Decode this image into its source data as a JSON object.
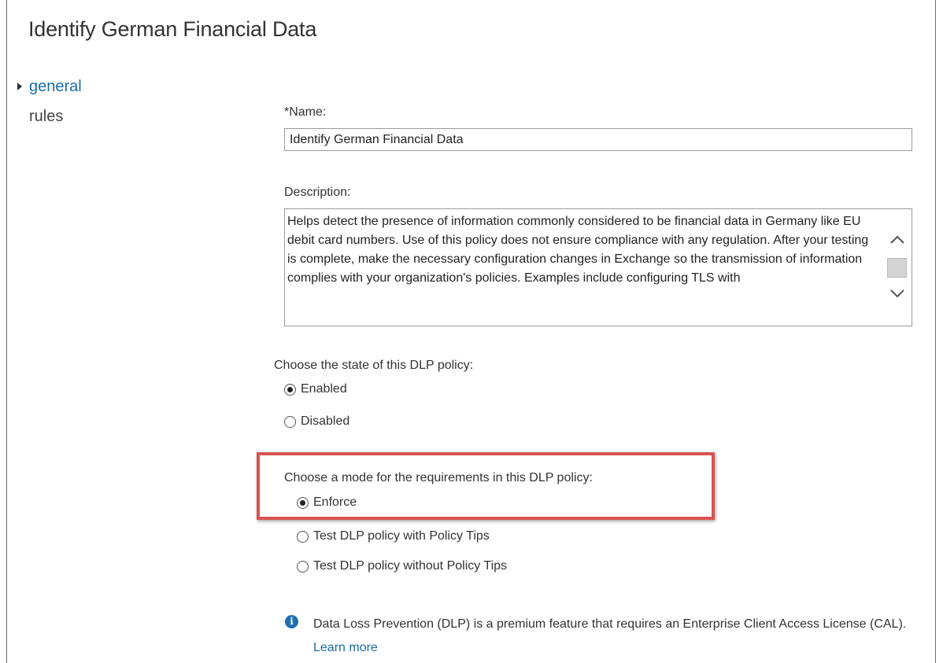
{
  "page": {
    "title": "Identify German Financial Data"
  },
  "nav": {
    "items": [
      {
        "label": "general",
        "active": true
      },
      {
        "label": "rules",
        "active": false
      }
    ]
  },
  "form": {
    "name_label": "*Name:",
    "name_value": "Identify German Financial Data",
    "description_label": "Description:",
    "description_value": "Helps detect the presence of information commonly considered to be financial data in Germany like EU debit card numbers. Use of this policy does not ensure compliance with any regulation. After your testing is complete, make the necessary configuration changes in Exchange so the transmission of information complies with your organization's policies.  Examples include configuring TLS with",
    "state_label": "Choose the state of this DLP policy:",
    "state_options": [
      {
        "label": "Enabled",
        "checked": true
      },
      {
        "label": "Disabled",
        "checked": false
      }
    ],
    "mode_label": "Choose a mode for the requirements in this DLP policy:",
    "mode_options": [
      {
        "label": "Enforce",
        "checked": true
      },
      {
        "label": "Test DLP policy with Policy Tips",
        "checked": false
      },
      {
        "label": "Test DLP policy without Policy Tips",
        "checked": false
      }
    ]
  },
  "info": {
    "icon": "info-icon",
    "text": "Data Loss Prevention (DLP) is a premium feature that requires an Enterprise Client Access License (CAL).",
    "link": "Learn more"
  },
  "colors": {
    "accent": "#1a6ca8",
    "highlight": "#d9534f",
    "info_icon": "#1f6fb2"
  }
}
